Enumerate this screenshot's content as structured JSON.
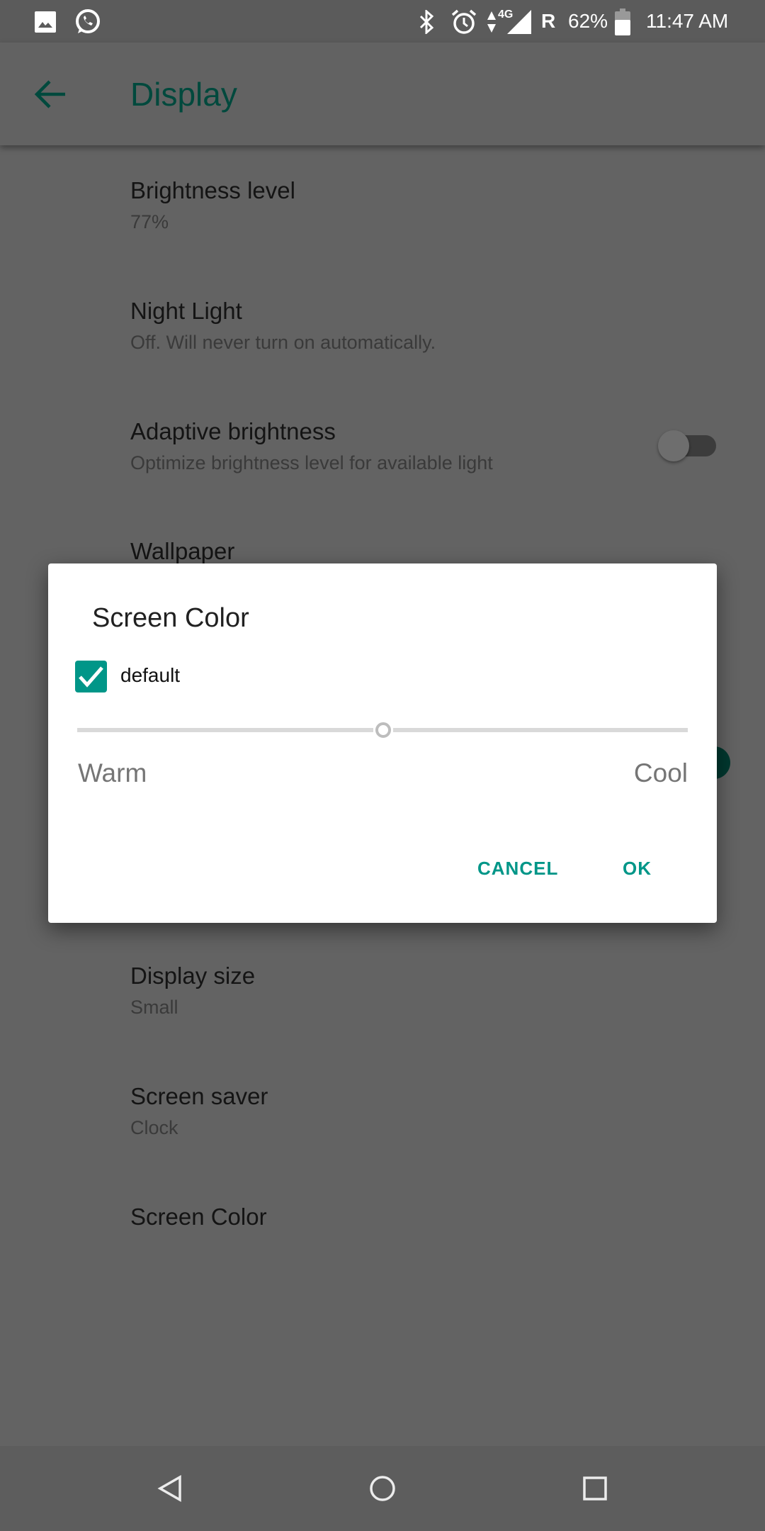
{
  "status_bar": {
    "battery": "62%",
    "time": "11:47 AM",
    "roaming": "R",
    "network": "4G",
    "icons": [
      "gallery-icon",
      "whatsapp-icon",
      "bluetooth-icon",
      "alarm-icon",
      "data-arrows-icon",
      "signal-icon",
      "battery-icon"
    ]
  },
  "app_bar": {
    "title": "Display",
    "back_icon": "arrow-left-icon"
  },
  "settings": [
    {
      "title": "Brightness level",
      "subtitle": "77%"
    },
    {
      "title": "Night Light",
      "subtitle": "Off. Will never turn on automatically."
    },
    {
      "title": "Adaptive brightness",
      "subtitle": "Optimize brightness level for available light",
      "toggle": false
    },
    {
      "title": "Wallpaper"
    },
    {
      "title": "Display size",
      "subtitle": "Small"
    },
    {
      "title": "Screen saver",
      "subtitle": "Clock"
    },
    {
      "title": "Screen Color"
    }
  ],
  "dialog": {
    "title": "Screen Color",
    "checkbox_label": "default",
    "checkbox_checked": true,
    "slider_value_percent": 50,
    "warm_label": "Warm",
    "cool_label": "Cool",
    "cancel": "CANCEL",
    "ok": "OK"
  },
  "colors": {
    "accent": "#009688"
  },
  "nav_bar": {
    "icons": [
      "back-triangle-icon",
      "home-circle-icon",
      "recents-square-icon"
    ]
  }
}
